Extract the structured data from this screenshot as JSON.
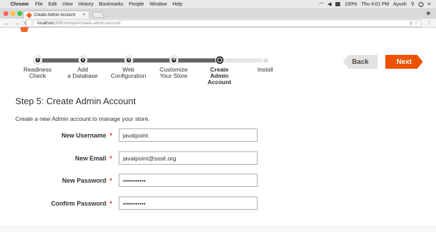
{
  "menubar": {
    "apple": "",
    "app": "Chrome",
    "items": [
      "File",
      "Edit",
      "View",
      "History",
      "Bookmarks",
      "People",
      "Window",
      "Help"
    ],
    "battery": "100%",
    "clock": "Thu 4:01 PM",
    "user": "Ayush"
  },
  "browser": {
    "tab_title": "Create Admin Account",
    "tab_close": "×",
    "url_host": "localhost",
    "url_path": ":8080/setup/#/create-admin-account",
    "back": "←",
    "forward": "→",
    "reload": "C"
  },
  "wizard": {
    "steps": [
      {
        "number": "1",
        "label_line1": "Readiness",
        "label_line2": "Check",
        "state": "done"
      },
      {
        "number": "2",
        "label_line1": "Add",
        "label_line2": "a Database",
        "state": "done"
      },
      {
        "number": "3",
        "label_line1": "Web",
        "label_line2": "Configuration",
        "state": "done"
      },
      {
        "number": "4",
        "label_line1": "Customize",
        "label_line2": "Your Store",
        "state": "done"
      },
      {
        "number": "5",
        "label_line1": "Create",
        "label_line2": "Admin Account",
        "state": "active"
      },
      {
        "number": "6",
        "label_line1": "Install",
        "label_line2": "",
        "state": "todo"
      }
    ],
    "back_label": "Back",
    "next_label": "Next"
  },
  "form": {
    "title": "Step 5: Create Admin Account",
    "description": "Create a new Admin account to manage your store.",
    "required_mark": "*",
    "fields": [
      {
        "label": "New Username",
        "value": "javatpoint",
        "type": "text"
      },
      {
        "label": "New Email",
        "value": "javatpoint@sssit.org",
        "type": "text"
      },
      {
        "label": "New Password",
        "value": "•••••••••••",
        "type": "password"
      },
      {
        "label": "Confirm Password",
        "value": "•••••••••••",
        "type": "password"
      }
    ]
  },
  "colors": {
    "accent": "#eb5202",
    "progress": "#666666",
    "required": "#e22626"
  }
}
